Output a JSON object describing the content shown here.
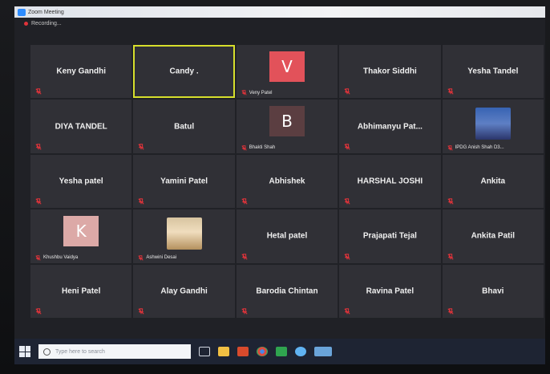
{
  "window": {
    "title": "Zoom Meeting"
  },
  "recording": {
    "label": "Recording..."
  },
  "participants": [
    {
      "name": "Keny Gandhi"
    },
    {
      "name": "Candy .",
      "active": true
    },
    {
      "name": "Veny Patel",
      "avatar_letter": "V"
    },
    {
      "name": "Thakor Siddhi"
    },
    {
      "name": "Yesha Tandel"
    },
    {
      "name": "DIYA TANDEL"
    },
    {
      "name": "Batul"
    },
    {
      "name": "Bhakti Shah",
      "avatar_letter": "B"
    },
    {
      "name": "Abhimanyu  Pat..."
    },
    {
      "name": "IPDG Anish Shah  D3...",
      "photo": true
    },
    {
      "name": "Yesha patel"
    },
    {
      "name": "Yamini Patel"
    },
    {
      "name": "Abhishek"
    },
    {
      "name": "HARSHAL JOSHI"
    },
    {
      "name": "Ankita"
    },
    {
      "name": "Khushbu Vaidya",
      "avatar_letter": "K"
    },
    {
      "name": "Ashwini Desai",
      "photo": true
    },
    {
      "name": "Hetal patel"
    },
    {
      "name": "Prajapati Tejal"
    },
    {
      "name": "Ankita Patil"
    },
    {
      "name": "Heni Patel"
    },
    {
      "name": "Alay Gandhi"
    },
    {
      "name": "Barodia Chintan"
    },
    {
      "name": "Ravina Patel"
    },
    {
      "name": "Bhavi"
    }
  ],
  "taskbar": {
    "search_placeholder": "Type here to search"
  },
  "colors": {
    "active_speaker": "#d7df2c",
    "tile_bg": "#303036",
    "muted_icon": "#e0333a"
  }
}
